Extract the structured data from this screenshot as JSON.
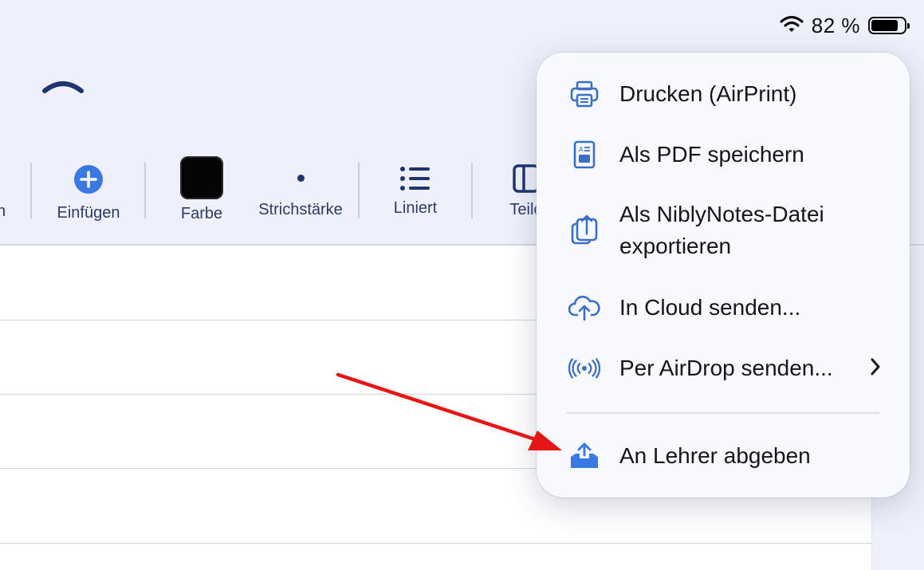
{
  "status_bar": {
    "battery_percent": "82 %",
    "battery_level": 0.82
  },
  "toolbar": {
    "cut_label": "n",
    "insert_label": "Einfügen",
    "color_label": "Farbe",
    "color_value": "#000000",
    "stroke_label": "Strichstärke",
    "lined_label": "Liniert",
    "share_label": "Teile"
  },
  "menu": {
    "items": [
      {
        "label": "Drucken (AirPrint)",
        "icon": "printer-icon"
      },
      {
        "label": "Als PDF speichern",
        "icon": "pdf-document-icon"
      },
      {
        "label_line1": "Als NiblyNotes-Datei",
        "label_line2": "exportieren",
        "icon": "share-export-icon"
      },
      {
        "label": "In Cloud senden...",
        "icon": "cloud-upload-icon"
      },
      {
        "label": "Per AirDrop senden...",
        "icon": "airdrop-icon",
        "has_submenu": true
      },
      {
        "label": "An Lehrer abgeben",
        "icon": "tray-upload-icon"
      }
    ]
  },
  "colors": {
    "accent": "#3a79e3",
    "icon_blue": "#3a6fc8",
    "annotation_arrow": "#e61616",
    "toolbar_text": "#2d3a66"
  }
}
